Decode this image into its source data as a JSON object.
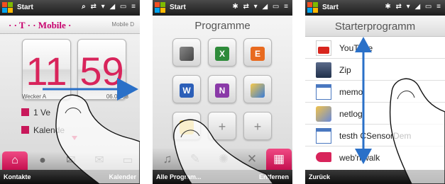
{
  "panels": [
    {
      "status": {
        "title": "Start",
        "icons": "⌕ ⇄ ▾ ◢ ▭ ≡"
      },
      "header": {
        "logo": "· · T · · Mobile ·",
        "right_label": "Mobile D"
      },
      "clock": {
        "hours": "11",
        "minutes": "59",
        "footer_left": "Wecker A",
        "footer_right": "06.06.08"
      },
      "items": [
        {
          "label": "1 Ve"
        },
        {
          "label": "Kalende"
        }
      ],
      "tabs": [
        "home-icon",
        "contacts-icon",
        "messages-icon",
        "mail-icon",
        "more-icon"
      ],
      "softkeys": {
        "left": "Kontakte",
        "right": "Kalender"
      }
    },
    {
      "status": {
        "title": "Start",
        "icons": "✱ ⇄ ▾ ◢ ▭ ≡"
      },
      "title": "Programme",
      "tiles": [
        {
          "name": "activesync",
          "glyph": "⇆"
        },
        {
          "name": "excel",
          "glyph": "X"
        },
        {
          "name": "office",
          "glyph": "E"
        },
        {
          "name": "word",
          "glyph": "W"
        },
        {
          "name": "onenote",
          "glyph": "N"
        },
        {
          "name": "notes",
          "glyph": "✎"
        },
        {
          "name": "file-explorer",
          "glyph": "▣"
        },
        {
          "name": "add-1",
          "glyph": "+"
        },
        {
          "name": "add-2",
          "glyph": "+"
        }
      ],
      "tabs": [
        "music-icon",
        "pen-icon",
        "settings-icon",
        "tools-icon",
        "programs-icon"
      ],
      "softkeys": {
        "left": "Alle Program...",
        "right": "Entfernen"
      }
    },
    {
      "status": {
        "title": "Start",
        "icons": "✱ ⇄ ▾ ◢ ▭ ≡"
      },
      "title": "Starterprogramm",
      "programs": [
        {
          "label": "YouTube",
          "icon": "youtube-icon"
        },
        {
          "label": "Zip",
          "icon": "zip-icon"
        },
        {
          "label": "memo",
          "icon": "window-icon"
        },
        {
          "label": "netlog",
          "icon": "netlog-icon"
        },
        {
          "label": "testh      CSensorDem",
          "icon": "window-icon"
        },
        {
          "label": "web'n'walk",
          "icon": "webnwalk-icon"
        }
      ],
      "softkeys": {
        "left": "Zurück",
        "right": ""
      }
    }
  ],
  "colors": {
    "magenta": "#d8245b",
    "tmobile": "#c8006e",
    "gesture_arrow": "#2a70c8"
  }
}
